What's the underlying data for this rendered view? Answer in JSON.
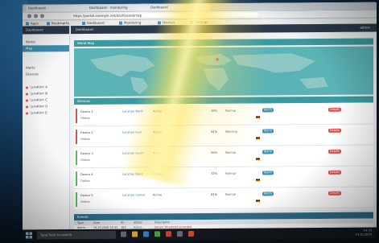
{
  "browser": {
    "tabs": [
      "Dashboard",
      "Dashboard - monitoring",
      "Dashboard"
    ],
    "url": "https://portal.example.net/dashboard/map",
    "bookmarks": [
      "Apps",
      "Bookmarks",
      "Dashboard",
      "Monitoring",
      "Devices",
      "Settings"
    ]
  },
  "sidebar": {
    "brand": "Dashboard",
    "items": [
      {
        "label": "Home",
        "active": false
      },
      {
        "label": "Map",
        "active": true
      },
      {
        "label": "Alerts",
        "active": false
      },
      {
        "label": "Devices",
        "active": false
      }
    ],
    "groups": [
      {
        "label": "Location A",
        "color": "#d9534f"
      },
      {
        "label": "Location B",
        "color": "#d9534f"
      },
      {
        "label": "Location C",
        "color": "#d9534f"
      },
      {
        "label": "Location D",
        "color": "#d9534f"
      },
      {
        "label": "Location E",
        "color": "#d9534f"
      }
    ]
  },
  "topbar": {
    "title": "Dashboard",
    "right": "admin"
  },
  "map_panel": {
    "title": "World Map"
  },
  "devices_panel": {
    "title": "Devices"
  },
  "rows": [
    {
      "status_color": "#d9534f",
      "name": "Device 1",
      "sub": "Online",
      "link": "Location North",
      "val": "Active",
      "pct": "18%",
      "state": "Normal",
      "flag": "DE",
      "badge1": "Alarm",
      "badge2": "Details"
    },
    {
      "status_color": "#d9534f",
      "name": "Device 2",
      "sub": "Online",
      "link": "Location East",
      "val": "Active",
      "pct": "44%",
      "state": "Warning",
      "flag": "DE",
      "badge1": "Alarm",
      "badge2": "Details"
    },
    {
      "status_color": "#5cb85c",
      "name": "Device 3",
      "sub": "Online",
      "link": "Location South",
      "val": "Active",
      "pct": "56%",
      "state": "Normal",
      "flag": "DE",
      "badge1": "Alarm",
      "badge2": "Details"
    },
    {
      "status_color": "#5cb85c",
      "name": "Device 4",
      "sub": "Online",
      "link": "Location West",
      "val": "Active",
      "pct": "72%",
      "state": "Normal",
      "flag": "DE",
      "badge1": "Alarm",
      "badge2": "Details"
    },
    {
      "status_color": "#5cb85c",
      "name": "Device 5",
      "sub": "Online",
      "link": "Location Center",
      "val": "Active",
      "pct": "81%",
      "state": "Normal",
      "flag": "DE",
      "badge1": "Alarm",
      "badge2": "Details"
    }
  ],
  "events": {
    "title": "Events",
    "columns": [
      "Type",
      "Date",
      "ID",
      "Status",
      "Description"
    ],
    "row": {
      "type": "Alarm",
      "date": "14.10.2020 14:33",
      "id": "103",
      "status": "Active",
      "desc": "Sensor threshold exceeded"
    }
  },
  "taskbar": {
    "search_placeholder": "Type here to search",
    "time": "14:33",
    "date": "14.10.2020"
  },
  "colors": {
    "accent": "#3b9aa0",
    "danger": "#d9534f",
    "ok": "#5cb85c"
  }
}
